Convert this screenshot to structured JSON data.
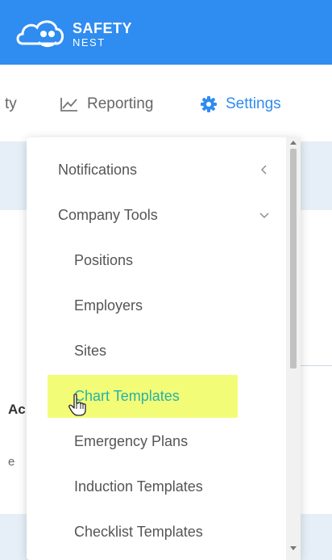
{
  "header": {
    "brand_line1": "SAFETY",
    "brand_line2": "NEST"
  },
  "nav": {
    "partial_label": "ty",
    "reporting_label": "Reporting",
    "settings_label": "Settings"
  },
  "background": {
    "partial_heading": "Ac",
    "partial_text": "e"
  },
  "menu": {
    "top_items": [
      {
        "label": "Notifications",
        "chevron": "chevron-left-icon"
      },
      {
        "label": "Company Tools",
        "chevron": "chevron-down-icon"
      }
    ],
    "sub_items": [
      {
        "label": "Positions"
      },
      {
        "label": "Employers"
      },
      {
        "label": "Sites"
      },
      {
        "label": "Chart Templates"
      },
      {
        "label": "Emergency Plans"
      },
      {
        "label": "Induction Templates"
      },
      {
        "label": "Checklist Templates"
      }
    ]
  },
  "colors": {
    "header_blue": "#2f8cf0",
    "active_item": "#26b1a8",
    "highlight": "#f0fb50"
  }
}
